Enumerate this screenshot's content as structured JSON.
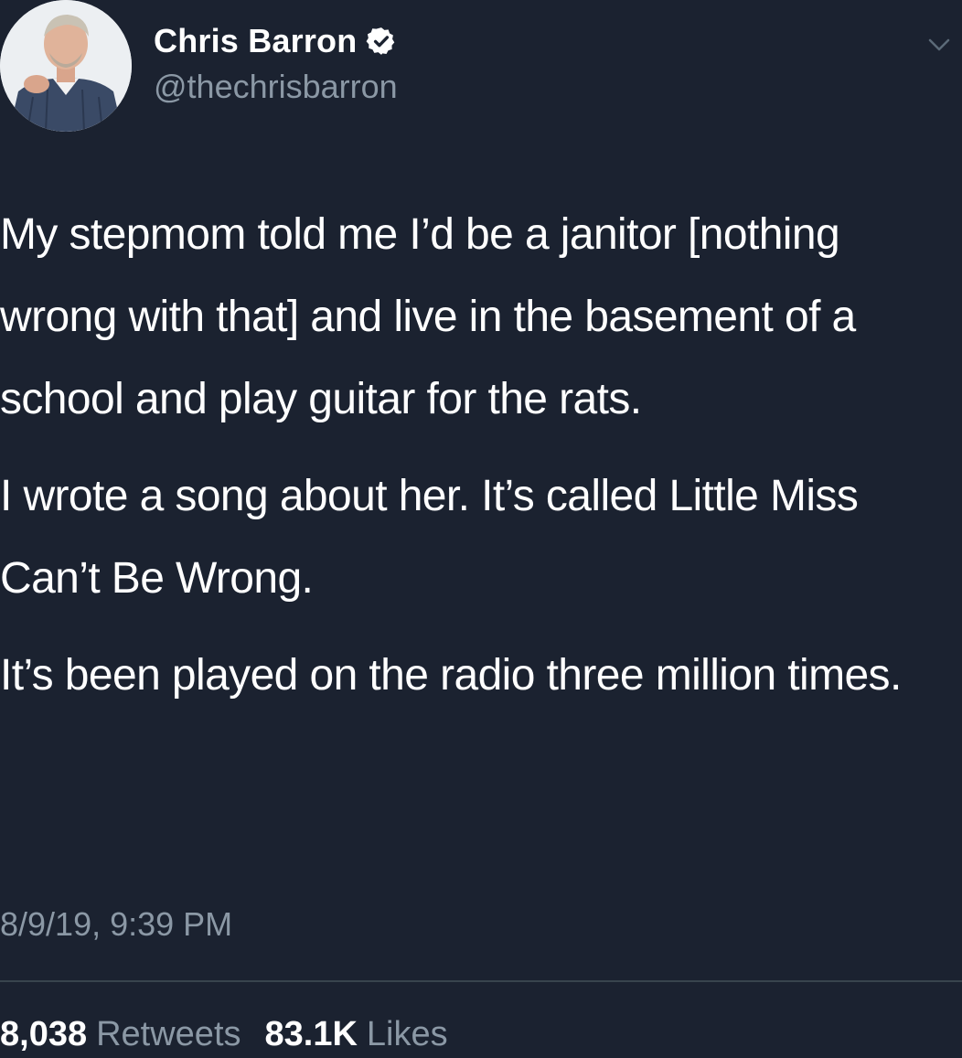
{
  "author": {
    "name": "Chris Barron",
    "handle": "@thechrisbarron",
    "verified": true
  },
  "tweet": {
    "paragraphs": [
      "My stepmom told me I’d be a janitor [nothing wrong with that] and live in the basement of a school and play guitar for the rats.",
      "I wrote a song about her. It’s called Little Miss Can’t Be Wrong.",
      "It’s been played on the radio three million times."
    ],
    "timestamp": "8/9/19, 9:39 PM"
  },
  "stats": {
    "retweets_count": "8,038",
    "retweets_label": "Retweets",
    "likes_count": "83.1K",
    "likes_label": "Likes"
  },
  "icons": {
    "verified": "verified-badge-icon",
    "menu": "chevron-down-icon"
  },
  "colors": {
    "background": "#1b2230",
    "secondary_text": "#8b98a5",
    "divider": "#38444d"
  }
}
